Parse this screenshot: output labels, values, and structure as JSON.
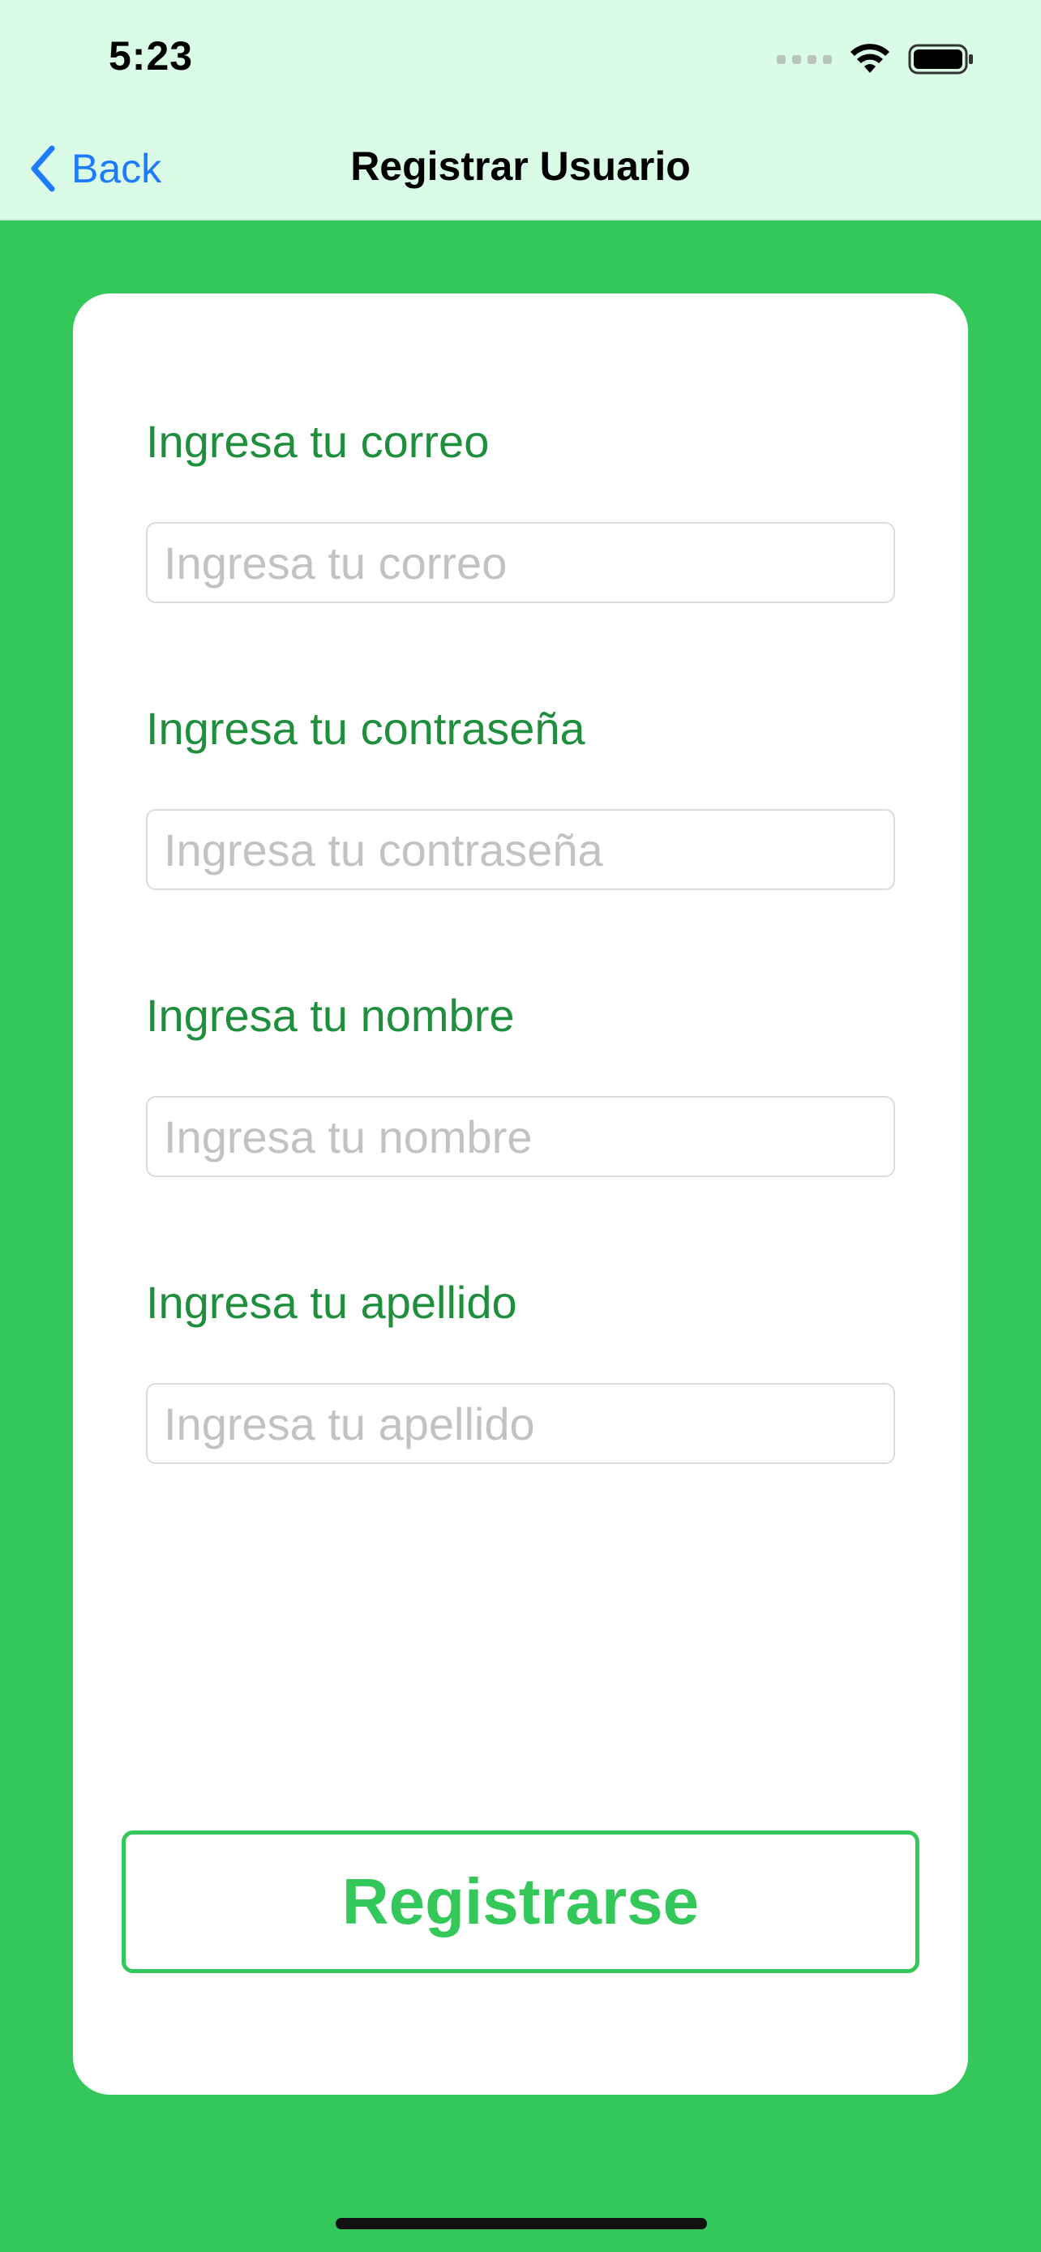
{
  "status_bar": {
    "time": "5:23",
    "icons": [
      "cellular-signal-icon",
      "wifi-icon",
      "battery-icon"
    ]
  },
  "nav": {
    "back_label": "Back",
    "title": "Registrar Usuario"
  },
  "form": {
    "fields": [
      {
        "label": "Ingresa tu correo",
        "placeholder": "Ingresa tu correo",
        "value": ""
      },
      {
        "label": "Ingresa tu contraseña",
        "placeholder": "Ingresa tu contraseña",
        "value": ""
      },
      {
        "label": "Ingresa tu nombre",
        "placeholder": "Ingresa tu nombre",
        "value": ""
      },
      {
        "label": "Ingresa tu apellido",
        "placeholder": "Ingresa tu apellido",
        "value": ""
      }
    ],
    "submit_label": "Registrarse"
  },
  "colors": {
    "background": "#34C759",
    "nav_background": "#DAFBE5",
    "label": "#1F8F3E",
    "link": "#1E7BFF",
    "card": "#FFFFFF"
  }
}
